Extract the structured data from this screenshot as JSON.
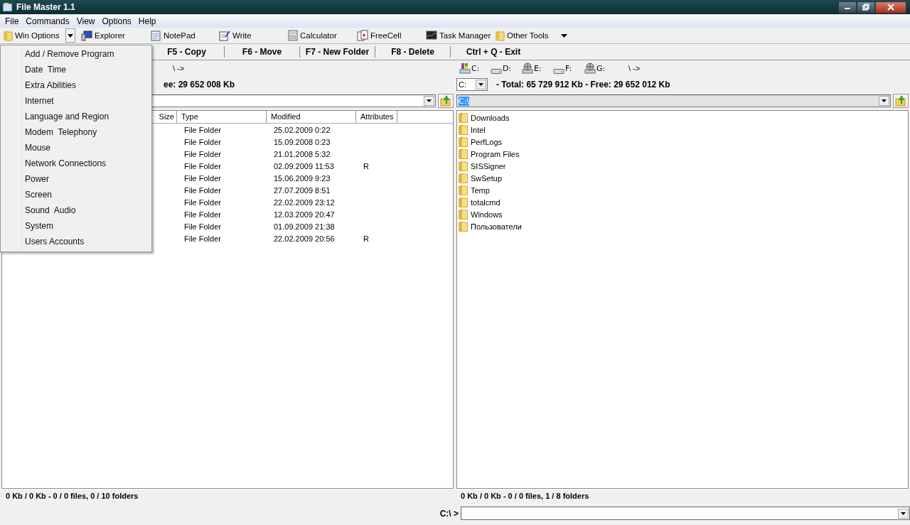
{
  "window": {
    "title": "File Master 1.1"
  },
  "menu_bar": [
    "File",
    "Commands",
    "View",
    "Options",
    "Help"
  ],
  "toolbar": [
    {
      "label": "Win Options",
      "kind": "split"
    },
    {
      "label": "Explorer",
      "kind": "button"
    },
    {
      "label": "NotePad",
      "kind": "button"
    },
    {
      "label": "Write",
      "kind": "button"
    },
    {
      "label": "Calculator",
      "kind": "button"
    },
    {
      "label": "FreeCell",
      "kind": "button"
    },
    {
      "label": "Task Manager",
      "kind": "button"
    },
    {
      "label": "Other Tools",
      "kind": "menu"
    }
  ],
  "win_options_menu": [
    "Add / Remove Program",
    "Date  Time",
    "Extra Abilities",
    "Internet",
    "Language and Region",
    "Modem  Telephony",
    "Mouse",
    "Network Connections",
    "Power",
    "Screen",
    "Sound  Audio",
    "System",
    "Users Accounts"
  ],
  "function_keys": [
    "F5 - Copy",
    "F6 - Move",
    "F7 - New Folder",
    "F8 - Delete",
    "Ctrl + Q - Exit"
  ],
  "left_panel": {
    "drives_path": "\\ ->",
    "free_info": "ee: 29 652 008 Kb",
    "columns": [
      "Size",
      "Type",
      "Modified",
      "Attributes"
    ],
    "rows": [
      {
        "type": "File Folder",
        "modified": "25.02.2009 0:22",
        "attributes": ""
      },
      {
        "type": "File Folder",
        "modified": "15.09.2008 0:23",
        "attributes": ""
      },
      {
        "type": "File Folder",
        "modified": "21.01.2008 5:32",
        "attributes": ""
      },
      {
        "type": "File Folder",
        "modified": "02.09.2009 11:53",
        "attributes": "R"
      },
      {
        "type": "File Folder",
        "modified": "15.06.2009 9:23",
        "attributes": ""
      },
      {
        "type": "File Folder",
        "modified": "27.07.2009 8:51",
        "attributes": ""
      },
      {
        "type": "File Folder",
        "modified": "22.02.2009 23:12",
        "attributes": ""
      },
      {
        "type": "File Folder",
        "modified": "12.03.2009 20:47",
        "attributes": ""
      },
      {
        "type": "File Folder",
        "modified": "01.09.2009 21:38",
        "attributes": ""
      },
      {
        "type": "File Folder",
        "modified": "22.02.2009 20:56",
        "attributes": "R"
      }
    ],
    "status": "0 Kb / 0 Kb - 0 / 0 files, 0 / 10 folders"
  },
  "right_panel": {
    "drives": [
      {
        "letter": "C:",
        "kind": "system"
      },
      {
        "letter": "D:",
        "kind": "disk"
      },
      {
        "letter": "E:",
        "kind": "network"
      },
      {
        "letter": "F:",
        "kind": "disk"
      },
      {
        "letter": "G:",
        "kind": "network"
      }
    ],
    "drives_path": "\\ ->",
    "drive_select": "C:",
    "free_info": "- Total: 65 729 912 Kb - Free: 29 652 012 Kb",
    "path": {
      "value": "C:\\",
      "selected": true
    },
    "items": [
      "Downloads",
      "Intel",
      "PerfLogs",
      "Program Files",
      "SISSigner",
      "SwSetup",
      "Temp",
      "totalcmd",
      "Windows",
      "Пользователи"
    ],
    "status": "0 Kb / 0 Kb - 0 / 0 files, 1 / 8 folders"
  },
  "command_line": {
    "prompt": "C:\\ >"
  }
}
